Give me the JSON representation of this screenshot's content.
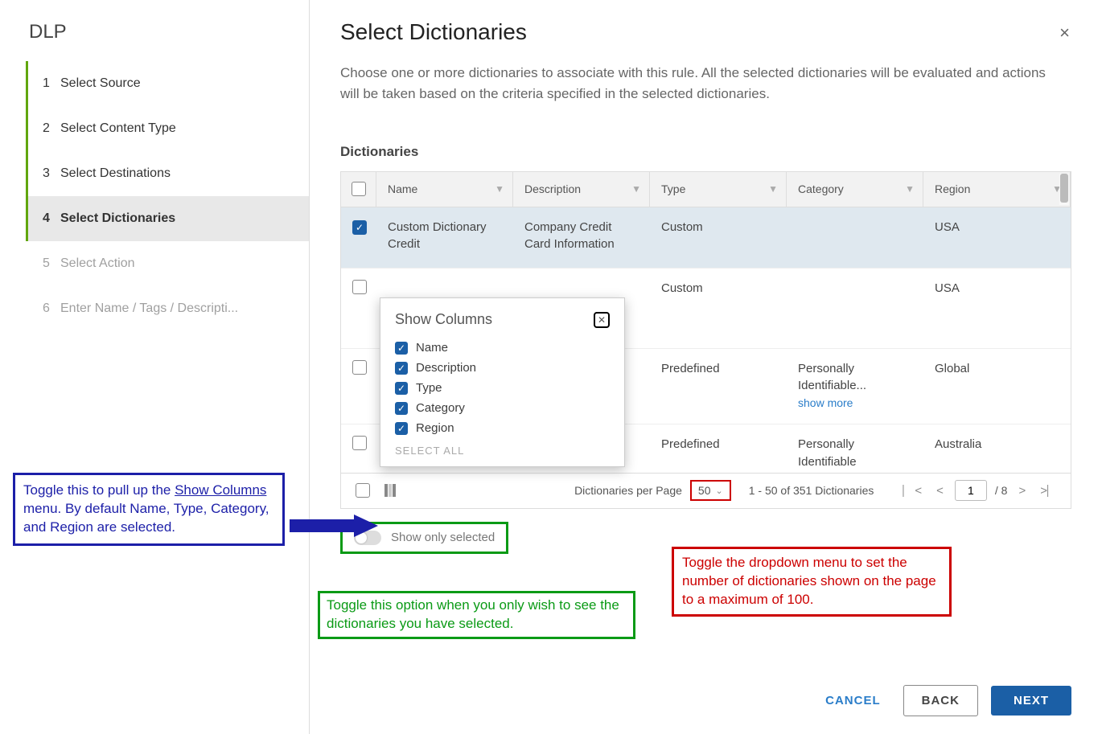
{
  "sidebar": {
    "title": "DLP",
    "steps": [
      {
        "num": "1",
        "label": "Select Source",
        "state": "done"
      },
      {
        "num": "2",
        "label": "Select Content Type",
        "state": "done"
      },
      {
        "num": "3",
        "label": "Select Destinations",
        "state": "done"
      },
      {
        "num": "4",
        "label": "Select Dictionaries",
        "state": "active"
      },
      {
        "num": "5",
        "label": "Select Action",
        "state": "future"
      },
      {
        "num": "6",
        "label": "Enter Name / Tags / Descripti...",
        "state": "future"
      }
    ]
  },
  "main": {
    "title": "Select Dictionaries",
    "close": "×",
    "description": "Choose one or more dictionaries to associate with this rule. All the selected dictionaries will be evaluated and actions will be taken based on the criteria specified in the selected dictionaries.",
    "section": "Dictionaries"
  },
  "table": {
    "columns": {
      "name": "Name",
      "desc": "Description",
      "type": "Type",
      "cat": "Category",
      "region": "Region"
    },
    "rows": [
      {
        "checked": true,
        "name": "Custom Dictionary Credit",
        "desc": "Company Credit Card Information",
        "type": "Custom",
        "cat": "",
        "region": "USA"
      },
      {
        "checked": false,
        "name": "",
        "desc": "",
        "type": "Custom",
        "cat": "",
        "region": "USA"
      },
      {
        "checked": false,
        "name": "",
        "desc": "",
        "type": "Predefined",
        "cat": "Personally Identifiable...",
        "showmore": "show more",
        "region": "Global"
      },
      {
        "checked": false,
        "name": "",
        "desc": "",
        "type": "Predefined",
        "cat": "Personally Identifiable",
        "region": "Australia"
      }
    ]
  },
  "footer": {
    "perPageLabel": "Dictionaries per Page",
    "perPageValue": "50",
    "rangeText": "1 - 50 of 351 Dictionaries",
    "pageCurrent": "1",
    "pageTotal": "8"
  },
  "showOnly": {
    "label": "Show only selected"
  },
  "popover": {
    "title": "Show Columns",
    "items": [
      "Name",
      "Description",
      "Type",
      "Category",
      "Region"
    ],
    "selectAll": "SELECT ALL"
  },
  "buttons": {
    "cancel": "CANCEL",
    "back": "BACK",
    "next": "NEXT"
  },
  "annotations": {
    "blue": "Toggle this to pull up the <u>Show Columns</u> menu. By default Name, Type, Category, and Region are selected.",
    "green": "Toggle this option when you only wish to see the dictionaries you have selected.",
    "red": "Toggle the dropdown menu to set the number of dictionaries shown on the page to a maximum of 100."
  }
}
